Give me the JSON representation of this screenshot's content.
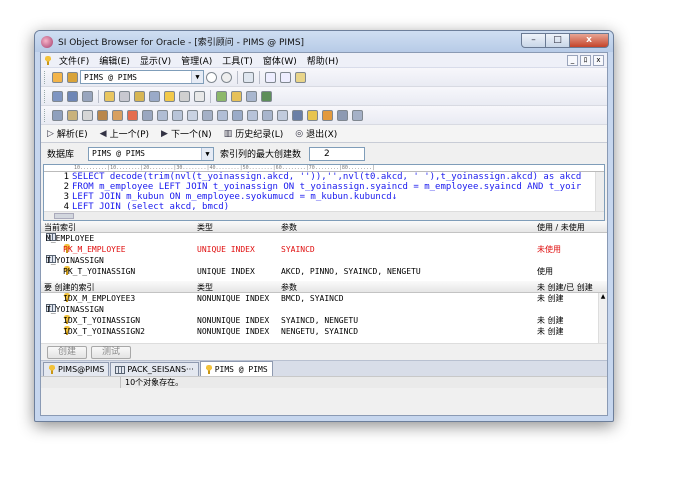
{
  "window": {
    "title": "SI Object Browser for Oracle - [索引顾问 - PIMS @ PIMS]",
    "buttons": {
      "minimize": "–",
      "maximize": "□",
      "close": "x"
    }
  },
  "menubar": {
    "items": [
      "文件(F)",
      "编辑(E)",
      "显示(V)",
      "管理(A)",
      "工具(T)",
      "窗体(W)",
      "帮助(H)"
    ],
    "mdi": [
      "_",
      "ﾛ",
      "x"
    ]
  },
  "connection_combo": "PIMS @ PIMS",
  "nav": {
    "analyze": "解析(E)",
    "prev": "上一个(P)",
    "next": "下一个(N)",
    "history": "历史纪录(L)",
    "exit": "退出(X)"
  },
  "db": {
    "label": "数据库",
    "value": "PIMS @ PIMS",
    "max_cols_label": "索引列的最大创建数",
    "max_cols_value": "2"
  },
  "editor": {
    "ruler": "10.........|10........|20........|30........|40........|50........|60........|70........|80........|",
    "lines": [
      {
        "num": "1",
        "text": "SELECT decode(trim(nvl(t_yoinassign.akcd, '')),'',nvl(t0.akcd, ' '),t_yoinassign.akcd) as akcd"
      },
      {
        "num": "2",
        "text": "FROM m_employee LEFT JOIN t_yoinassign ON t_yoinassign.syaincd = m_employee.syaincd AND t_yoir"
      },
      {
        "num": "3",
        "text": "LEFT JOIN m_kubun ON m_employee.syokumucd = m_kubun.kubuncd↓"
      },
      {
        "num": "4",
        "text": "LEFT JOIN (select akcd, bmcd)"
      }
    ]
  },
  "current_index": {
    "headers": {
      "name": "当前索引",
      "type": "类型",
      "param": "参数",
      "usage": "使用 / 未使用"
    },
    "tables": [
      {
        "name": "M_EMPLOYEE",
        "rows": [
          {
            "name": "PK_M_EMPLOYEE",
            "type": "UNIQUE INDEX",
            "param": "SYAINCD",
            "usage": "未使用"
          }
        ]
      },
      {
        "name": "T_YOINASSIGN",
        "rows": [
          {
            "name": "PK_T_YOINASSIGN",
            "type": "UNIQUE INDEX",
            "param": "AKCD, PINNO, SYAINCD, NENGETU",
            "usage": "使用"
          }
        ]
      }
    ]
  },
  "required_index": {
    "headers": {
      "name": "要 创建的索引",
      "type": "类型",
      "param": "参数",
      "usage": "未 创建/已 创建"
    },
    "rows_top": [
      {
        "name": "IDX_M_EMPLOYEE3",
        "type": "NONUNIQUE INDEX",
        "param": "BMCD, SYAINCD",
        "usage": "未 创建"
      }
    ],
    "table2": "T_YOINASSIGN",
    "rows_bottom": [
      {
        "name": "IDX_T_YOINASSIGN",
        "type": "NONUNIQUE INDEX",
        "param": "SYAINCD, NENGETU",
        "usage": "未 创建"
      },
      {
        "name": "IDX_T_YOINASSIGN2",
        "type": "NONUNIQUE INDEX",
        "param": "NENGETU, SYAINCD",
        "usage": "未 创建"
      }
    ]
  },
  "buttons": {
    "create": "创建",
    "test": "测试"
  },
  "tabs": [
    "PIMS@PIMS",
    "PACK_SEISANS···",
    "PIMS @ PIMS"
  ],
  "status": "10个对象存在。"
}
